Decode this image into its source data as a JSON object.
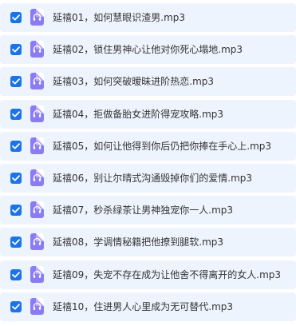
{
  "files": [
    {
      "name": "延禧01，如何慧眼识渣男.mp3",
      "checked": true
    },
    {
      "name": "延禧02，锁住男神心让他对你死心塌地.mp3",
      "checked": true
    },
    {
      "name": "延禧03，如何突破暧昧进阶热恋.mp3",
      "checked": true
    },
    {
      "name": "延禧04，拒做备胎女进阶得宠攻略.mp3",
      "checked": true
    },
    {
      "name": "延禧05，如何让他得到你后仍把你捧在手心上.mp3",
      "checked": true
    },
    {
      "name": "延禧06，别让尔晴式沟通毁掉你们的爱情.mp3",
      "checked": true
    },
    {
      "name": "延禧07，秒杀绿茶让男神独宠你一人.mp3",
      "checked": true
    },
    {
      "name": "延禧08，学调情秘籍把他撩到腿软.mp3",
      "checked": true
    },
    {
      "name": "延禧09，失宠不存在成为让他舍不得离开的女人.mp3",
      "checked": true
    },
    {
      "name": "延禧10，住进男人心里成为无可替代.mp3",
      "checked": true
    }
  ],
  "colors": {
    "row_bg": "#eef4fe",
    "checkbox": "#1a73e8",
    "file_icon": "#8b7cf6",
    "text": "#333333"
  },
  "icons": {
    "checkbox": "checkmark-icon",
    "file": "audio-file-icon"
  }
}
